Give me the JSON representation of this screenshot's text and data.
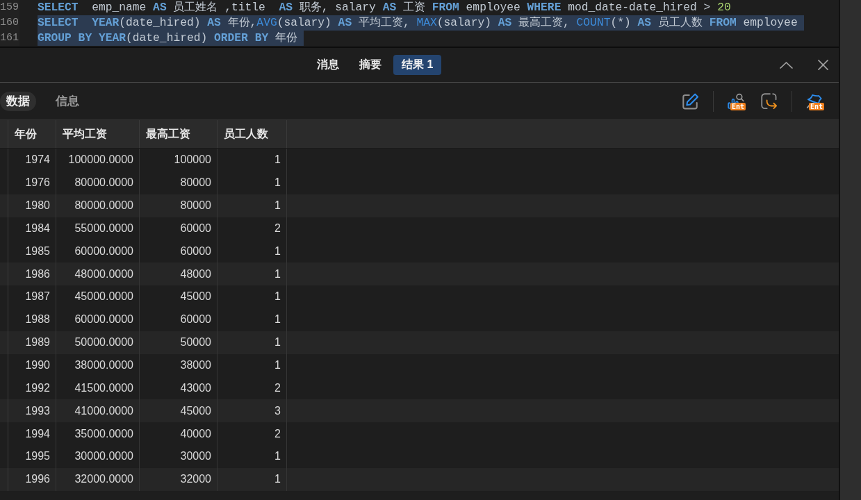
{
  "editor": {
    "lines": [
      {
        "number": "159",
        "selected": false,
        "tokens": [
          {
            "kind": "keyword",
            "text": "SELECT"
          },
          {
            "kind": "plain",
            "text": "  emp_name "
          },
          {
            "kind": "keyword",
            "text": "AS"
          },
          {
            "kind": "plain",
            "text": " 员工姓名 ,title  "
          },
          {
            "kind": "keyword",
            "text": "AS"
          },
          {
            "kind": "plain",
            "text": " 职务, salary "
          },
          {
            "kind": "keyword",
            "text": "AS"
          },
          {
            "kind": "plain",
            "text": " 工资 "
          },
          {
            "kind": "keyword",
            "text": "FROM"
          },
          {
            "kind": "plain",
            "text": " employee "
          },
          {
            "kind": "keyword",
            "text": "WHERE"
          },
          {
            "kind": "plain",
            "text": " mod_date-date_hired > "
          },
          {
            "kind": "number",
            "text": "20"
          }
        ]
      },
      {
        "number": "160",
        "selected": true,
        "tokens": [
          {
            "kind": "keyword",
            "text": "SELECT  YEAR"
          },
          {
            "kind": "plain",
            "text": "(date_hired) "
          },
          {
            "kind": "keyword",
            "text": "AS"
          },
          {
            "kind": "plain",
            "text": " 年份,"
          },
          {
            "kind": "function",
            "text": "AVG"
          },
          {
            "kind": "plain",
            "text": "(salary) "
          },
          {
            "kind": "keyword",
            "text": "AS"
          },
          {
            "kind": "plain",
            "text": " 平均工资, "
          },
          {
            "kind": "function",
            "text": "MAX"
          },
          {
            "kind": "plain",
            "text": "(salary) "
          },
          {
            "kind": "keyword",
            "text": "AS"
          },
          {
            "kind": "plain",
            "text": " 最高工资, "
          },
          {
            "kind": "function",
            "text": "COUNT"
          },
          {
            "kind": "plain",
            "text": "(*) "
          },
          {
            "kind": "keyword",
            "text": "AS"
          },
          {
            "kind": "plain",
            "text": " 员工人数 "
          },
          {
            "kind": "keyword",
            "text": "FROM"
          },
          {
            "kind": "plain",
            "text": " employee"
          }
        ]
      },
      {
        "number": "161",
        "selected": true,
        "tokens": [
          {
            "kind": "keyword",
            "text": "GROUP BY YEAR"
          },
          {
            "kind": "plain",
            "text": "(date_hired) "
          },
          {
            "kind": "keyword",
            "text": "ORDER BY"
          },
          {
            "kind": "plain",
            "text": " 年份"
          }
        ]
      }
    ]
  },
  "result_tabs": {
    "tabs": [
      {
        "label": "消息",
        "selected": false
      },
      {
        "label": "摘要",
        "selected": false
      },
      {
        "label": "结果 1",
        "selected": true
      }
    ]
  },
  "view_tabs": {
    "tabs": [
      {
        "label": "数据",
        "selected": true
      },
      {
        "label": "信息",
        "selected": false
      }
    ],
    "actions": [
      {
        "kind": "edit"
      },
      {
        "kind": "divider"
      },
      {
        "kind": "chart",
        "badge": "Ent"
      },
      {
        "kind": "export"
      },
      {
        "kind": "divider"
      },
      {
        "kind": "pin",
        "badge": "Ent"
      }
    ]
  },
  "table": {
    "columns": [
      "年份",
      "平均工资",
      "最高工资",
      "员工人数"
    ],
    "rows": [
      [
        "1974",
        "100000.0000",
        "100000",
        "1"
      ],
      [
        "1976",
        "80000.0000",
        "80000",
        "1"
      ],
      [
        "1980",
        "80000.0000",
        "80000",
        "1"
      ],
      [
        "1984",
        "55000.0000",
        "60000",
        "2"
      ],
      [
        "1985",
        "60000.0000",
        "60000",
        "1"
      ],
      [
        "1986",
        "48000.0000",
        "48000",
        "1"
      ],
      [
        "1987",
        "45000.0000",
        "45000",
        "1"
      ],
      [
        "1988",
        "60000.0000",
        "60000",
        "1"
      ],
      [
        "1989",
        "50000.0000",
        "50000",
        "1"
      ],
      [
        "1990",
        "38000.0000",
        "38000",
        "1"
      ],
      [
        "1992",
        "41500.0000",
        "43000",
        "2"
      ],
      [
        "1993",
        "41000.0000",
        "45000",
        "3"
      ],
      [
        "1994",
        "35000.0000",
        "40000",
        "2"
      ],
      [
        "1995",
        "30000.0000",
        "30000",
        "1"
      ],
      [
        "1996",
        "32000.0000",
        "32000",
        "1"
      ]
    ]
  }
}
